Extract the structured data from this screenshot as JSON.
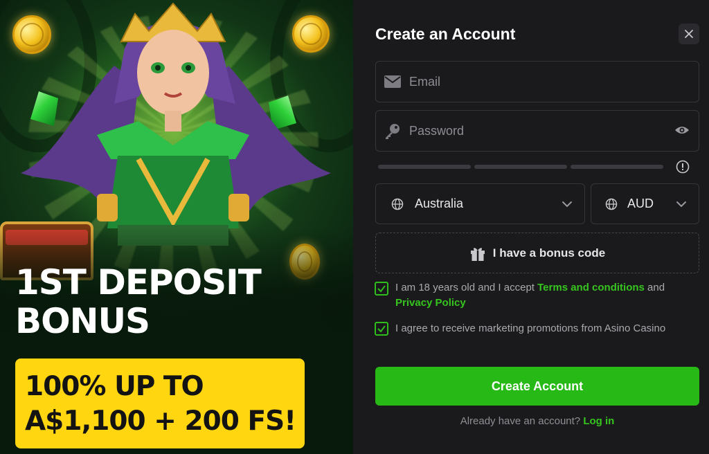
{
  "promo": {
    "headline_line1": "1ST DEPOSIT",
    "headline_line2": "BONUS",
    "offer_line1": "100% UP TO",
    "offer_line2": "A$1,100 + 200 FS!"
  },
  "form": {
    "title": "Create an Account",
    "email_placeholder": "Email",
    "password_placeholder": "Password",
    "country": "Australia",
    "currency": "AUD",
    "bonus_code_label": "I have a bonus code",
    "terms": {
      "prefix": "I am 18 years old and I accept ",
      "terms_link": "Terms and conditions",
      "middle": " and",
      "privacy_link": "Privacy Policy",
      "checked": true
    },
    "marketing": {
      "text": "I agree to receive marketing promotions from Asino Casino",
      "checked": true
    },
    "submit_label": "Create Account",
    "login_prompt": "Already have an account?",
    "login_link": "Log in"
  },
  "colors": {
    "accent_green": "#27b915",
    "link_green": "#36c51e",
    "offer_yellow": "#ffd60f",
    "panel_bg": "#1a1a1d"
  },
  "icons": [
    "close-icon",
    "envelope-icon",
    "key-icon",
    "eye-icon",
    "info-icon",
    "globe-icon",
    "chevron-down-icon",
    "gift-icon",
    "checkmark-icon"
  ]
}
